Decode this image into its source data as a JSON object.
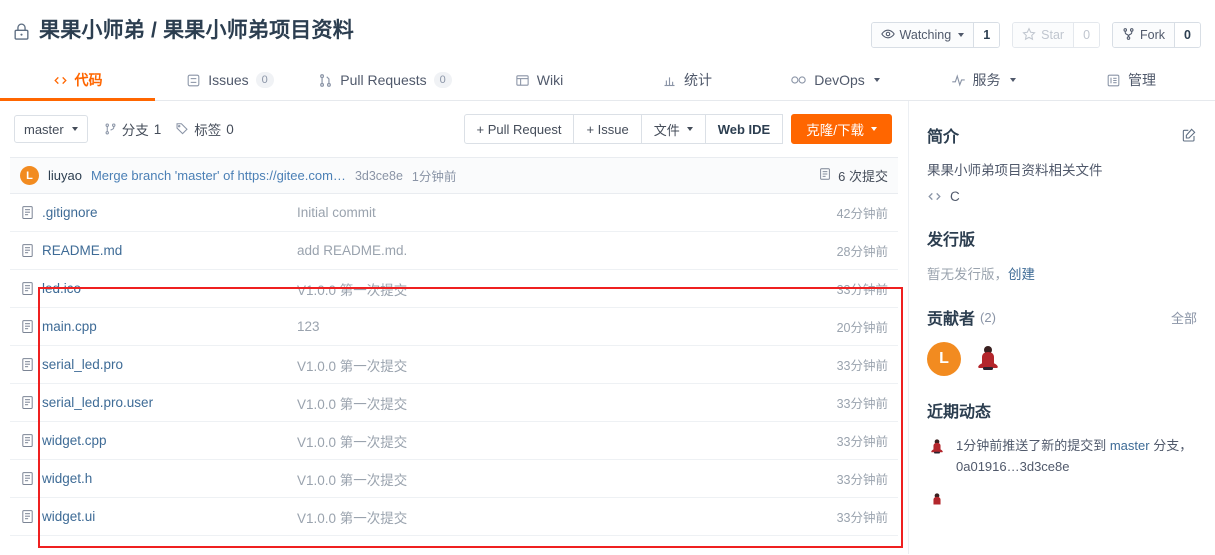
{
  "header": {
    "lock_icon": "lock-icon",
    "owner": "果果小师弟",
    "separator": "/",
    "repo": "果果小师弟项目资料",
    "full_title": "果果小师弟 / 果果小师弟项目资料",
    "watch": {
      "icon": "eye-icon",
      "label": "Watching",
      "count": "1"
    },
    "star": {
      "icon": "star-icon",
      "label": "Star",
      "count": "0"
    },
    "fork": {
      "icon": "fork-icon",
      "label": "Fork",
      "count": "0"
    }
  },
  "nav": {
    "tabs": [
      {
        "label": "代码",
        "icon": "code-icon",
        "active": true,
        "count": null
      },
      {
        "label": "Issues",
        "icon": "issue-icon",
        "active": false,
        "count": "0"
      },
      {
        "label": "Pull Requests",
        "icon": "pull-request-icon",
        "active": false,
        "count": "0"
      },
      {
        "label": "Wiki",
        "icon": "wiki-icon",
        "active": false,
        "count": null
      },
      {
        "label": "统计",
        "icon": "chart-icon",
        "active": false,
        "count": null
      },
      {
        "label": "DevOps",
        "icon": "infinity-icon",
        "active": false,
        "count": null,
        "dropdown": true
      },
      {
        "label": "服务",
        "icon": "pulse-icon",
        "active": false,
        "count": null,
        "dropdown": true
      },
      {
        "label": "管理",
        "icon": "settings-icon",
        "active": false,
        "count": null
      }
    ]
  },
  "toolbar": {
    "branch": "master",
    "branches": {
      "icon": "branch-icon",
      "label": "分支",
      "count": "1"
    },
    "tags": {
      "icon": "tag-icon",
      "label": "标签",
      "count": "0"
    },
    "pull_request_btn": "+ Pull Request",
    "issue_btn": "+ Issue",
    "files_btn": "文件",
    "webide_btn": "Web IDE",
    "clone_btn": "克隆/下载"
  },
  "commit_bar": {
    "avatar_letter": "L",
    "author": "liuyao",
    "message": "Merge branch 'master' of https://gitee.com…",
    "sha": "3d3ce8e",
    "time": "1分钟前",
    "commits_icon": "history-icon",
    "commits_label": "6 次提交"
  },
  "files": [
    {
      "icon": "file-icon",
      "name": ".gitignore",
      "message": "Initial commit",
      "time": "42分钟前"
    },
    {
      "icon": "file-icon",
      "name": "README.md",
      "message": "add README.md.",
      "time": "28分钟前"
    },
    {
      "icon": "file-icon",
      "name": "led.ico",
      "message": "V1.0.0 第一次提交",
      "time": "33分钟前"
    },
    {
      "icon": "file-icon",
      "name": "main.cpp",
      "message": "123",
      "time": "20分钟前"
    },
    {
      "icon": "file-icon",
      "name": "serial_led.pro",
      "message": "V1.0.0 第一次提交",
      "time": "33分钟前"
    },
    {
      "icon": "file-icon",
      "name": "serial_led.pro.user",
      "message": "V1.0.0 第一次提交",
      "time": "33分钟前"
    },
    {
      "icon": "file-icon",
      "name": "widget.cpp",
      "message": "V1.0.0 第一次提交",
      "time": "33分钟前"
    },
    {
      "icon": "file-icon",
      "name": "widget.h",
      "message": "V1.0.0 第一次提交",
      "time": "33分钟前"
    },
    {
      "icon": "file-icon",
      "name": "widget.ui",
      "message": "V1.0.0 第一次提交",
      "time": "33分钟前"
    }
  ],
  "annotation": {
    "type": "red-rectangle-highlight",
    "color": "#ef2020"
  },
  "sidebar": {
    "intro": {
      "title": "简介",
      "edit_icon": "edit-icon",
      "description": "果果小师弟项目资料相关文件",
      "language_icon": "code-icon",
      "language": "C"
    },
    "releases": {
      "title": "发行版",
      "empty_text": "暂无发行版，",
      "create_link": "创建"
    },
    "contributors": {
      "title": "贡献者",
      "count": "(2)",
      "all_link": "全部",
      "avatars": [
        {
          "type": "letter",
          "letter": "L"
        },
        {
          "type": "image",
          "name": "sitting-person-avatar"
        }
      ]
    },
    "activity": {
      "title": "近期动态",
      "items": [
        {
          "avatar": "sitting-person-avatar",
          "text_before": "1分钟前推送了新的提交到 ",
          "branch": "master",
          "text_after": " 分支，0a01916…3d3ce8e"
        }
      ]
    }
  },
  "colors": {
    "accent": "#ff6600",
    "link": "#3e6b96",
    "muted": "#9aa3ae",
    "annotation": "#ef2020"
  }
}
